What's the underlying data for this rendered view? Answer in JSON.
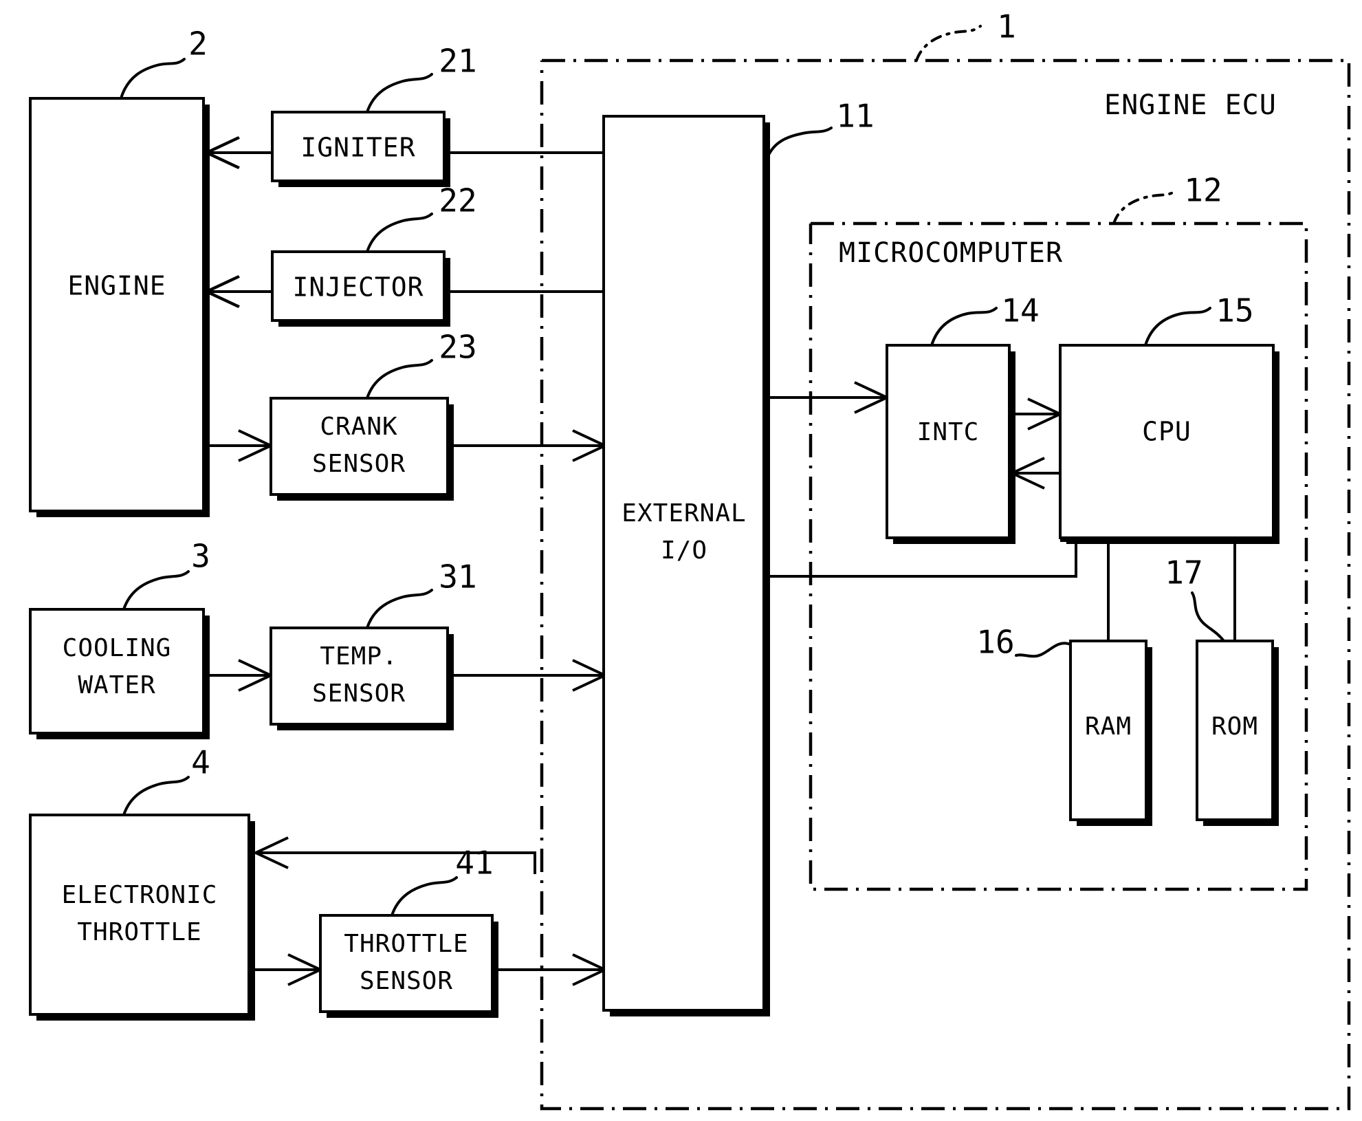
{
  "figure": {
    "outer_region_label": "ENGINE ECU",
    "outer_region_ref": "1",
    "inner_region_label": "MICROCOMPUTER",
    "inner_region_ref": "12"
  },
  "blocks": {
    "engine": {
      "label": "ENGINE",
      "ref": "2"
    },
    "igniter": {
      "label": "IGNITER",
      "ref": "21"
    },
    "injector": {
      "label": "INJECTOR",
      "ref": "22"
    },
    "crank_sensor": {
      "line1": "CRANK",
      "line2": "SENSOR",
      "ref": "23"
    },
    "cooling_water": {
      "line1": "COOLING",
      "line2": "WATER",
      "ref": "3"
    },
    "temp_sensor": {
      "line1": "TEMP.",
      "line2": "SENSOR",
      "ref": "31"
    },
    "electronic_throttle": {
      "line1": "ELECTRONIC",
      "line2": "THROTTLE",
      "ref": "4"
    },
    "throttle_sensor": {
      "line1": "THROTTLE",
      "line2": "SENSOR",
      "ref": "41"
    },
    "external_io": {
      "line1": "EXTERNAL",
      "line2": "I/O",
      "ref": "11"
    },
    "intc": {
      "label": "INTC",
      "ref": "14"
    },
    "cpu": {
      "label": "CPU",
      "ref": "15"
    },
    "ram": {
      "label": "RAM",
      "ref": "16"
    },
    "rom": {
      "label": "ROM",
      "ref": "17"
    }
  },
  "colors": {
    "ink": "#000000",
    "paper": "#ffffff"
  }
}
